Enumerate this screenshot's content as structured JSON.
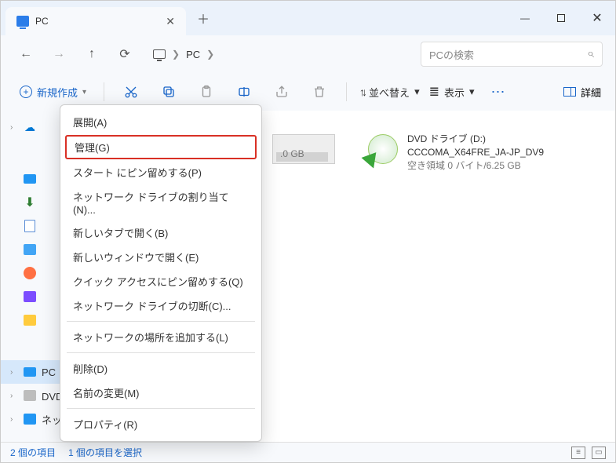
{
  "titlebar": {
    "tab_title": "PC"
  },
  "navbar": {
    "location": "PC"
  },
  "search": {
    "placeholder": "PCの検索"
  },
  "actionbar": {
    "new_label": "新規作成",
    "sort_label": "並べ替え",
    "view_label": "表示",
    "details_label": "詳細"
  },
  "sidebar": {
    "pc_label": "PC",
    "dvd_label": "DVD ドライブ (D:)",
    "network_label": "ネットワーク"
  },
  "main": {
    "capacity_hint": ".0 GB",
    "dvd": {
      "line1": "DVD ドライブ (D:)",
      "line2": "CCCOMA_X64FRE_JA-JP_DV9",
      "line3": "空き領域 0 バイト/6.25 GB"
    }
  },
  "context_menu": {
    "items": [
      "展開(A)",
      "管理(G)",
      "スタート にピン留めする(P)",
      "ネットワーク ドライブの割り当て(N)...",
      "新しいタブで開く(B)",
      "新しいウィンドウで開く(E)",
      "クイック アクセスにピン留めする(Q)",
      "ネットワーク ドライブの切断(C)..."
    ],
    "group2": [
      "ネットワークの場所を追加する(L)"
    ],
    "group3": [
      "削除(D)",
      "名前の変更(M)"
    ],
    "group4": [
      "プロパティ(R)"
    ],
    "highlighted_index": 1
  },
  "statusbar": {
    "count": "2 個の項目",
    "selection": "1 個の項目を選択"
  }
}
